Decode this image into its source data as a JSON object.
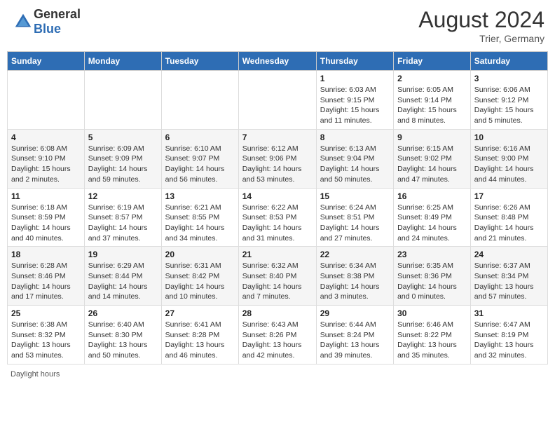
{
  "header": {
    "logo_general": "General",
    "logo_blue": "Blue",
    "month_year": "August 2024",
    "location": "Trier, Germany"
  },
  "weekdays": [
    "Sunday",
    "Monday",
    "Tuesday",
    "Wednesday",
    "Thursday",
    "Friday",
    "Saturday"
  ],
  "weeks": [
    [
      {
        "day": "",
        "info": ""
      },
      {
        "day": "",
        "info": ""
      },
      {
        "day": "",
        "info": ""
      },
      {
        "day": "",
        "info": ""
      },
      {
        "day": "1",
        "info": "Sunrise: 6:03 AM\nSunset: 9:15 PM\nDaylight: 15 hours and 11 minutes."
      },
      {
        "day": "2",
        "info": "Sunrise: 6:05 AM\nSunset: 9:14 PM\nDaylight: 15 hours and 8 minutes."
      },
      {
        "day": "3",
        "info": "Sunrise: 6:06 AM\nSunset: 9:12 PM\nDaylight: 15 hours and 5 minutes."
      }
    ],
    [
      {
        "day": "4",
        "info": "Sunrise: 6:08 AM\nSunset: 9:10 PM\nDaylight: 15 hours and 2 minutes."
      },
      {
        "day": "5",
        "info": "Sunrise: 6:09 AM\nSunset: 9:09 PM\nDaylight: 14 hours and 59 minutes."
      },
      {
        "day": "6",
        "info": "Sunrise: 6:10 AM\nSunset: 9:07 PM\nDaylight: 14 hours and 56 minutes."
      },
      {
        "day": "7",
        "info": "Sunrise: 6:12 AM\nSunset: 9:06 PM\nDaylight: 14 hours and 53 minutes."
      },
      {
        "day": "8",
        "info": "Sunrise: 6:13 AM\nSunset: 9:04 PM\nDaylight: 14 hours and 50 minutes."
      },
      {
        "day": "9",
        "info": "Sunrise: 6:15 AM\nSunset: 9:02 PM\nDaylight: 14 hours and 47 minutes."
      },
      {
        "day": "10",
        "info": "Sunrise: 6:16 AM\nSunset: 9:00 PM\nDaylight: 14 hours and 44 minutes."
      }
    ],
    [
      {
        "day": "11",
        "info": "Sunrise: 6:18 AM\nSunset: 8:59 PM\nDaylight: 14 hours and 40 minutes."
      },
      {
        "day": "12",
        "info": "Sunrise: 6:19 AM\nSunset: 8:57 PM\nDaylight: 14 hours and 37 minutes."
      },
      {
        "day": "13",
        "info": "Sunrise: 6:21 AM\nSunset: 8:55 PM\nDaylight: 14 hours and 34 minutes."
      },
      {
        "day": "14",
        "info": "Sunrise: 6:22 AM\nSunset: 8:53 PM\nDaylight: 14 hours and 31 minutes."
      },
      {
        "day": "15",
        "info": "Sunrise: 6:24 AM\nSunset: 8:51 PM\nDaylight: 14 hours and 27 minutes."
      },
      {
        "day": "16",
        "info": "Sunrise: 6:25 AM\nSunset: 8:49 PM\nDaylight: 14 hours and 24 minutes."
      },
      {
        "day": "17",
        "info": "Sunrise: 6:26 AM\nSunset: 8:48 PM\nDaylight: 14 hours and 21 minutes."
      }
    ],
    [
      {
        "day": "18",
        "info": "Sunrise: 6:28 AM\nSunset: 8:46 PM\nDaylight: 14 hours and 17 minutes."
      },
      {
        "day": "19",
        "info": "Sunrise: 6:29 AM\nSunset: 8:44 PM\nDaylight: 14 hours and 14 minutes."
      },
      {
        "day": "20",
        "info": "Sunrise: 6:31 AM\nSunset: 8:42 PM\nDaylight: 14 hours and 10 minutes."
      },
      {
        "day": "21",
        "info": "Sunrise: 6:32 AM\nSunset: 8:40 PM\nDaylight: 14 hours and 7 minutes."
      },
      {
        "day": "22",
        "info": "Sunrise: 6:34 AM\nSunset: 8:38 PM\nDaylight: 14 hours and 3 minutes."
      },
      {
        "day": "23",
        "info": "Sunrise: 6:35 AM\nSunset: 8:36 PM\nDaylight: 14 hours and 0 minutes."
      },
      {
        "day": "24",
        "info": "Sunrise: 6:37 AM\nSunset: 8:34 PM\nDaylight: 13 hours and 57 minutes."
      }
    ],
    [
      {
        "day": "25",
        "info": "Sunrise: 6:38 AM\nSunset: 8:32 PM\nDaylight: 13 hours and 53 minutes."
      },
      {
        "day": "26",
        "info": "Sunrise: 6:40 AM\nSunset: 8:30 PM\nDaylight: 13 hours and 50 minutes."
      },
      {
        "day": "27",
        "info": "Sunrise: 6:41 AM\nSunset: 8:28 PM\nDaylight: 13 hours and 46 minutes."
      },
      {
        "day": "28",
        "info": "Sunrise: 6:43 AM\nSunset: 8:26 PM\nDaylight: 13 hours and 42 minutes."
      },
      {
        "day": "29",
        "info": "Sunrise: 6:44 AM\nSunset: 8:24 PM\nDaylight: 13 hours and 39 minutes."
      },
      {
        "day": "30",
        "info": "Sunrise: 6:46 AM\nSunset: 8:22 PM\nDaylight: 13 hours and 35 minutes."
      },
      {
        "day": "31",
        "info": "Sunrise: 6:47 AM\nSunset: 8:19 PM\nDaylight: 13 hours and 32 minutes."
      }
    ]
  ],
  "footer": {
    "daylight_label": "Daylight hours"
  }
}
